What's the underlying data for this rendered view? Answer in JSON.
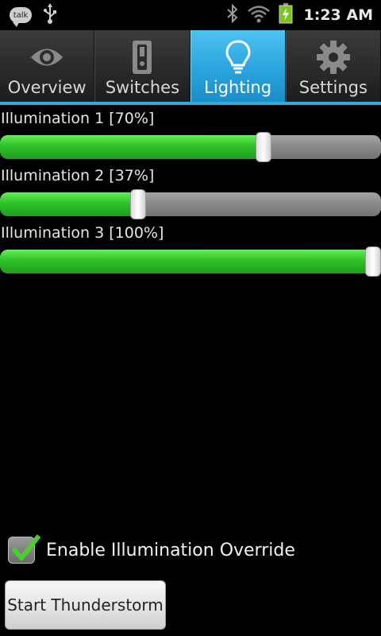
{
  "status_bar": {
    "talk_label": "talk",
    "time": "1:23 AM",
    "icons": [
      "talk-icon",
      "usb-icon",
      "bluetooth-icon",
      "wifi-icon",
      "battery-charging-icon"
    ]
  },
  "tabs": [
    {
      "label": "Overview",
      "icon": "eye-icon",
      "selected": false
    },
    {
      "label": "Switches",
      "icon": "switch-icon",
      "selected": false
    },
    {
      "label": "Lighting",
      "icon": "lightbulb-icon",
      "selected": true
    },
    {
      "label": "Settings",
      "icon": "gear-icon",
      "selected": false
    }
  ],
  "sliders": [
    {
      "label": "Illumination 1 [70%]",
      "value_percent": 70
    },
    {
      "label": "Illumination 2 [37%]",
      "value_percent": 37
    },
    {
      "label": "Illumination 3 [100%]",
      "value_percent": 100
    }
  ],
  "override": {
    "label": "Enable Illumination Override",
    "checked": true
  },
  "thunder_button": {
    "label": "Start Thunderstorm"
  },
  "colors": {
    "accent": "#33aadd",
    "slider_fill": "#2fc22a",
    "checkmark": "#4ccf2a"
  }
}
